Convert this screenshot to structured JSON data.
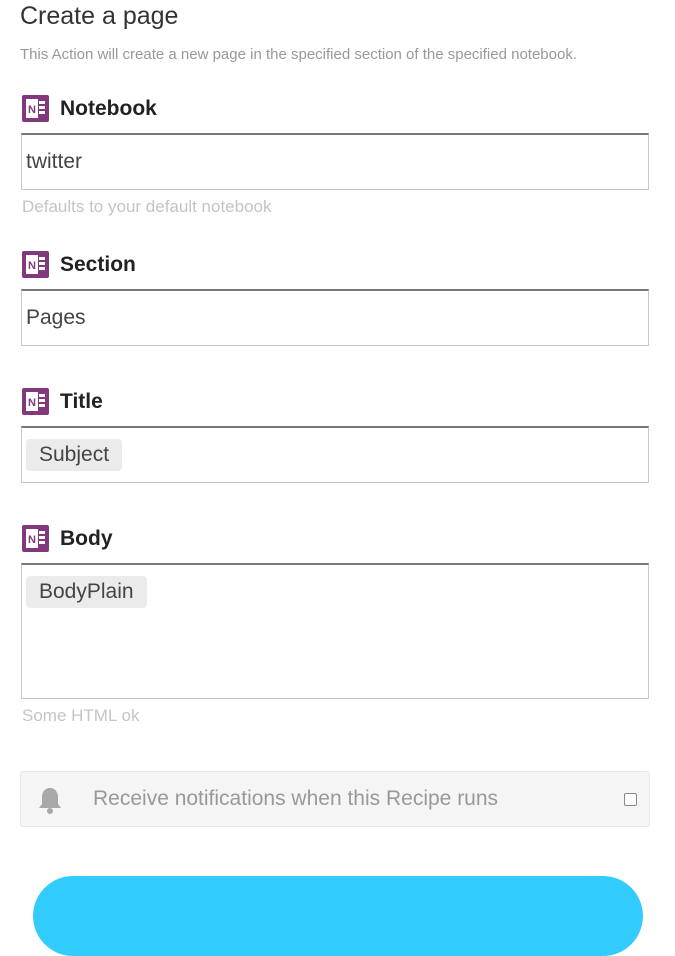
{
  "page": {
    "title": "Create a page",
    "description": "This Action will create a new page in the specified section of the specified notebook."
  },
  "fields": {
    "notebook": {
      "label": "Notebook",
      "value": "twitter",
      "helper": "Defaults to your default notebook",
      "icon": "onenote-icon"
    },
    "section": {
      "label": "Section",
      "value": "Pages",
      "icon": "onenote-icon"
    },
    "title": {
      "label": "Title",
      "ingredient": "Subject",
      "icon": "onenote-icon"
    },
    "body": {
      "label": "Body",
      "ingredient": "BodyPlain",
      "helper": "Some HTML ok",
      "icon": "onenote-icon"
    }
  },
  "notifications": {
    "label": "Receive notifications when this Recipe runs",
    "checked": false,
    "icon": "bell-icon"
  },
  "colors": {
    "onenote_purple": "#80397b",
    "button_blue": "#33ccff"
  }
}
